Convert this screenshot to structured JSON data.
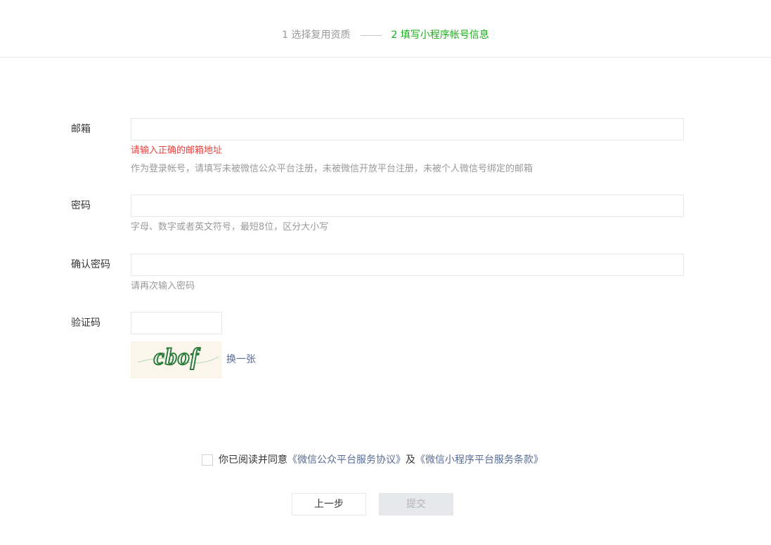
{
  "steps": [
    {
      "label": "1 选择复用资质",
      "state": "done"
    },
    {
      "label": "2 填写小程序帐号信息",
      "state": "active"
    }
  ],
  "colors": {
    "accent": "#1aad19",
    "error": "#e64340",
    "link": "#576b95",
    "muted": "#9a9a9a"
  },
  "form": {
    "email": {
      "label": "邮箱",
      "value": "",
      "error": "请输入正确的邮箱地址",
      "tip": "作为登录帐号，请填写未被微信公众平台注册，未被微信开放平台注册，未被个人微信号绑定的邮箱"
    },
    "password": {
      "label": "密码",
      "value": "",
      "tip": "字母、数字或者英文符号，最短8位，区分大小写"
    },
    "confirm": {
      "label": "确认密码",
      "value": "",
      "tip": "请再次输入密码"
    },
    "captcha": {
      "label": "验证码",
      "value": "",
      "image_text": "cbof",
      "refresh": "换一张"
    }
  },
  "agreement": {
    "checked": false,
    "prefix": "你已阅读并同意",
    "link1": "《微信公众平台服务协议》",
    "middle": "及",
    "link2": "《微信小程序平台服务条款》"
  },
  "buttons": {
    "prev": "上一步",
    "submit": "提交"
  }
}
